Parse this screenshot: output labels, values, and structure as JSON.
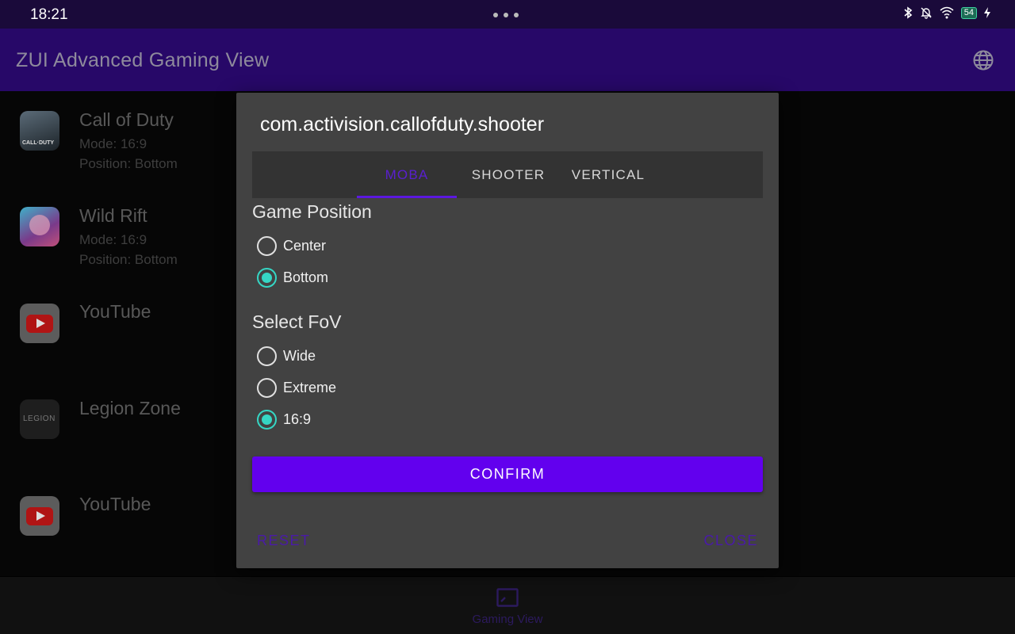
{
  "status_bar": {
    "time": "18:21",
    "battery": "54"
  },
  "app_bar": {
    "title": "ZUI Advanced Gaming View"
  },
  "app_list": [
    {
      "title": "Call of Duty",
      "mode": "Mode: 16:9",
      "position": "Position: Bottom",
      "icon": "call-of-duty-icon",
      "icon_text": "CALL·DUTY"
    },
    {
      "title": "Wild Rift",
      "mode": "Mode: 16:9",
      "position": "Position: Bottom",
      "icon": "wild-rift-icon"
    },
    {
      "title": "YouTube",
      "icon": "youtube-icon"
    },
    {
      "title": "Legion Zone",
      "icon": "legion-icon",
      "icon_text": "LEGION"
    },
    {
      "title": "YouTube",
      "icon": "youtube-icon"
    }
  ],
  "bottom_nav": {
    "label": "Gaming View"
  },
  "dialog": {
    "title": "com.activision.callofduty.shooter",
    "tabs": [
      {
        "label": "MOBA",
        "active": true
      },
      {
        "label": "SHOOTER",
        "active": false
      },
      {
        "label": "VERTICAL",
        "active": false
      }
    ],
    "game_position": {
      "title": "Game Position",
      "options": [
        {
          "label": "Center",
          "selected": false
        },
        {
          "label": "Bottom",
          "selected": true
        }
      ]
    },
    "fov": {
      "title": "Select FoV",
      "options": [
        {
          "label": "Wide",
          "selected": false
        },
        {
          "label": "Extreme",
          "selected": false
        },
        {
          "label": "16:9",
          "selected": true
        }
      ]
    },
    "confirm_label": "CONFIRM",
    "reset_label": "RESET",
    "close_label": "CLOSE"
  },
  "colors": {
    "accent": "#6200ee",
    "radio_checked": "#35d6c4",
    "app_bar": "#270868",
    "dialog_bg": "#424242"
  }
}
